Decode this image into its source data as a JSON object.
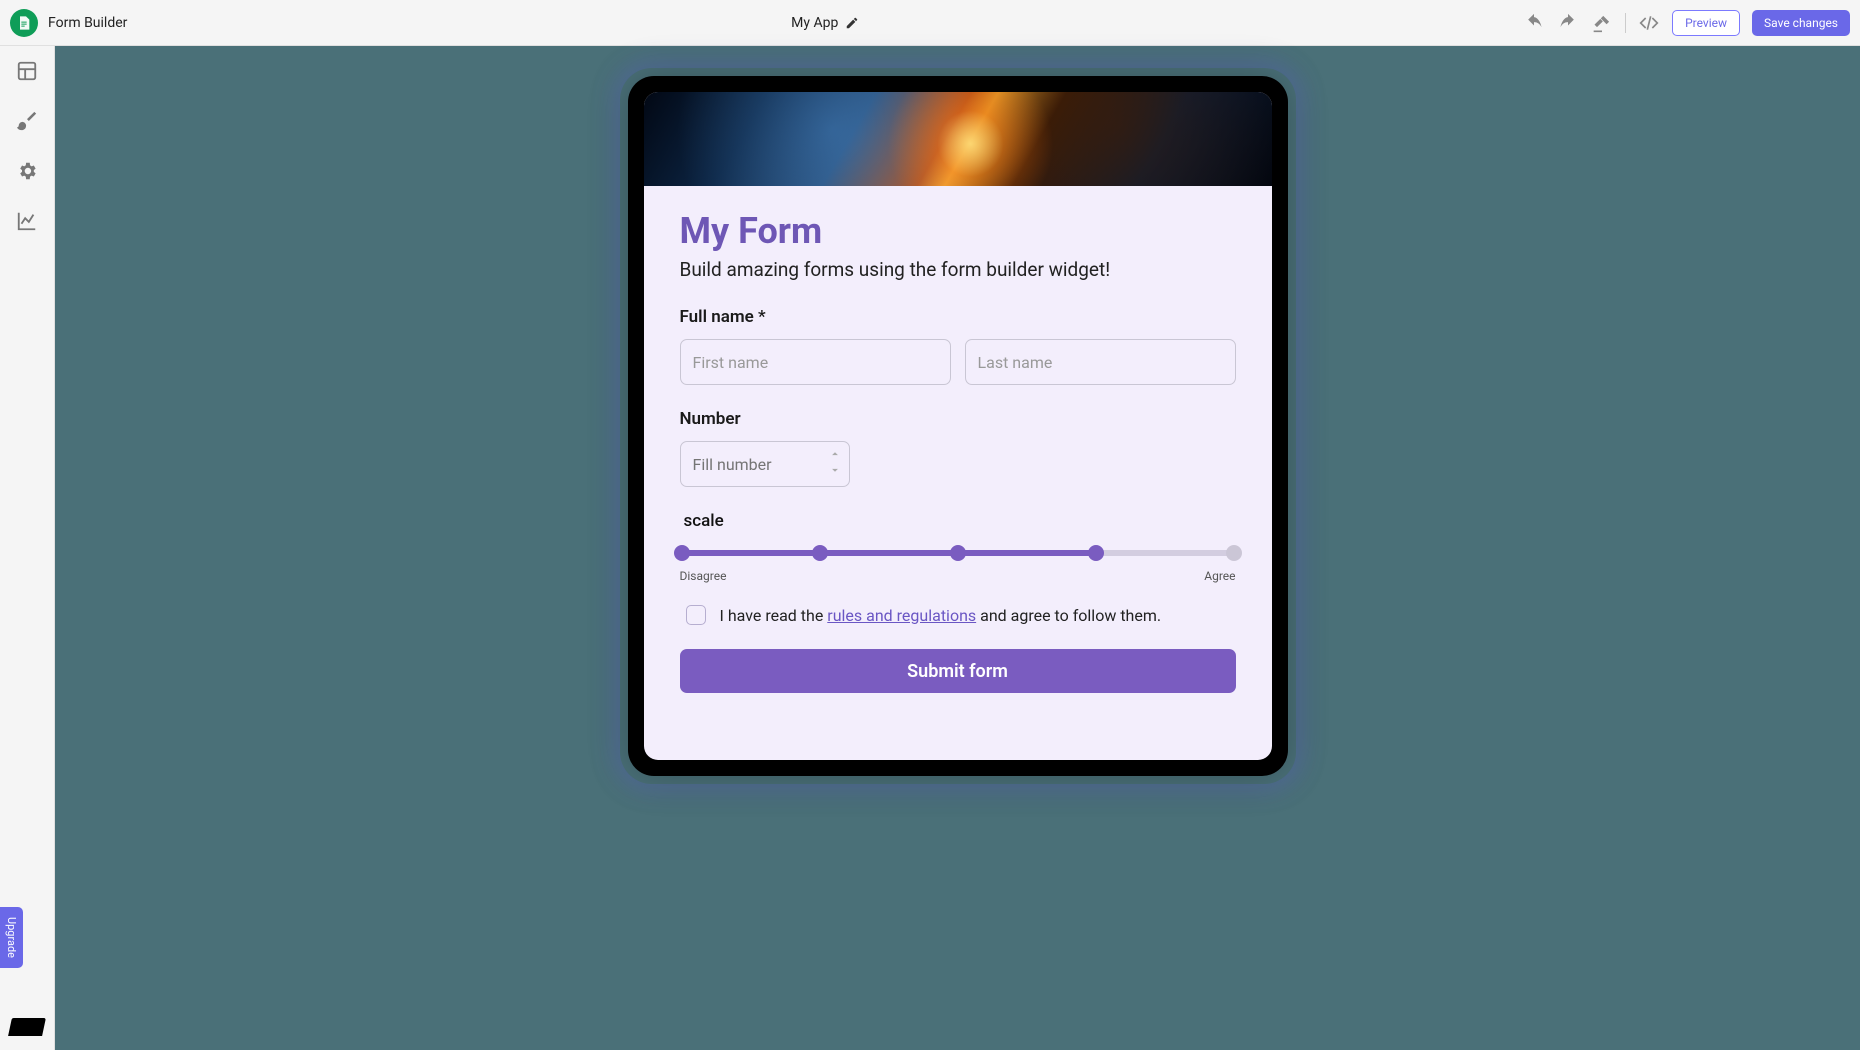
{
  "topbar": {
    "product_title": "Form Builder",
    "app_name": "My App",
    "preview_label": "Preview",
    "save_label": "Save changes"
  },
  "leftrail": {
    "upgrade_label": "Upgrade"
  },
  "form": {
    "title": "My Form",
    "subtitle": "Build amazing forms using the form builder widget!",
    "full_name_label": "Full name *",
    "first_name_placeholder": "First name",
    "last_name_placeholder": "Last name",
    "number_label": "Number",
    "number_placeholder": "Fill number",
    "scale_label": "scale",
    "scale_left": "Disagree",
    "scale_right": "Agree",
    "scale_points": 5,
    "scale_value": 4,
    "terms_prefix": "I have read the ",
    "terms_link": "rules and regulations",
    "terms_suffix": " and agree to follow them.",
    "submit_label": "Submit form"
  }
}
